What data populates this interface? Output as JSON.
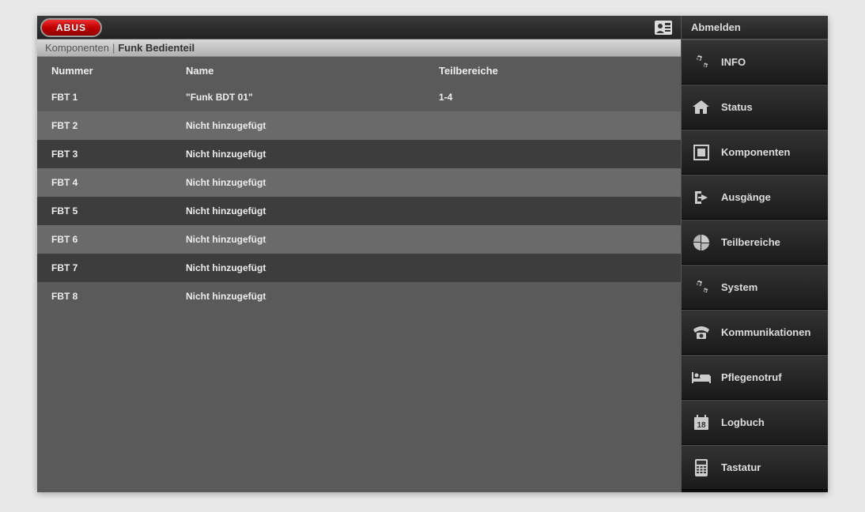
{
  "brand": "ABUS",
  "logout_label": "Abmelden",
  "breadcrumb": {
    "main": "Komponenten",
    "sep": "|",
    "current": "Funk Bedienteil"
  },
  "table": {
    "headers": {
      "num": "Nummer",
      "name": "Name",
      "area": "Teilbereiche"
    },
    "rows": [
      {
        "num": "FBT 1",
        "name": "\"Funk BDT 01\"",
        "area": "1-4"
      },
      {
        "num": "FBT 2",
        "name": "Nicht hinzugefügt",
        "area": ""
      },
      {
        "num": "FBT 3",
        "name": "Nicht hinzugefügt",
        "area": ""
      },
      {
        "num": "FBT 4",
        "name": "Nicht hinzugefügt",
        "area": ""
      },
      {
        "num": "FBT 5",
        "name": "Nicht hinzugefügt",
        "area": ""
      },
      {
        "num": "FBT 6",
        "name": "Nicht hinzugefügt",
        "area": ""
      },
      {
        "num": "FBT 7",
        "name": "Nicht hinzugefügt",
        "area": ""
      },
      {
        "num": "FBT 8",
        "name": "Nicht hinzugefügt",
        "area": ""
      }
    ]
  },
  "nav": {
    "info": "INFO",
    "status": "Status",
    "komponenten": "Komponenten",
    "ausgaenge": "Ausgänge",
    "teilbereiche": "Teilbereiche",
    "system": "System",
    "kommunikationen": "Kommunikationen",
    "pflegenotruf": "Pflegenotruf",
    "logbuch": "Logbuch",
    "tastatur": "Tastatur"
  },
  "logbuch_day": "18"
}
